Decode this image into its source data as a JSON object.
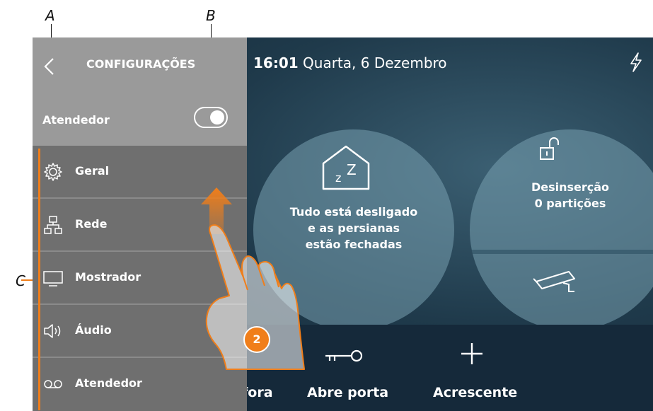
{
  "callouts": {
    "a": "A",
    "b": "B",
    "c": "C"
  },
  "status": {
    "time": "16:01",
    "date": "Quarta, 6 Dezembro"
  },
  "scenario": {
    "line1": "Tudo está desligado",
    "line2": "e as persianas",
    "line3": "estão fechadas"
  },
  "alarm": {
    "line1": "Desinserção",
    "line2": "0 partições"
  },
  "bottom": {
    "partial": "fora",
    "door": "Abre porta",
    "add": "Acrescente"
  },
  "panel": {
    "title": "CONFIGURAÇÕES",
    "answering_label": "Atendedor",
    "answering_toggle": "on",
    "items": [
      {
        "label": "Geral",
        "icon": "gear-icon"
      },
      {
        "label": "Rede",
        "icon": "network-icon"
      },
      {
        "label": "Mostrador",
        "icon": "display-icon"
      },
      {
        "label": "Áudio",
        "icon": "speaker-icon"
      },
      {
        "label": "Atendedor",
        "icon": "voicemail-icon"
      }
    ]
  },
  "step_badge": "2",
  "colors": {
    "accent": "#f07e1a",
    "panel": "#6f6f6f",
    "panel_header": "#9a9a9a",
    "background": "#1f3a4b"
  }
}
